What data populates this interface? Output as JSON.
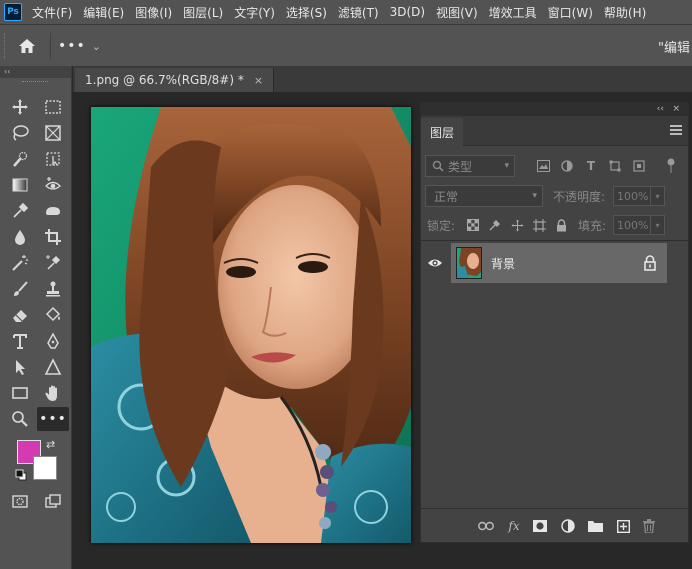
{
  "app": {
    "logo": "Ps",
    "menu": [
      "文件(F)",
      "编辑(E)",
      "图像(I)",
      "图层(L)",
      "文字(Y)",
      "选择(S)",
      "滤镜(T)",
      "3D(D)",
      "视图(V)",
      "增效工具",
      "窗口(W)",
      "帮助(H)"
    ]
  },
  "options_bar": {
    "more_label": "•••",
    "more_chevron": "⌄",
    "right_label": "\"编辑"
  },
  "toolbar": {
    "collapse_glyph": "‹‹"
  },
  "document": {
    "tab_title": "1.png @ 66.7%(RGB/8#) *",
    "tab_close": "×"
  },
  "layers_panel": {
    "collapse_glyph": "‹‹",
    "close_glyph": "×",
    "tab_label": "图层",
    "filter_label": "类型",
    "blend_mode": "正常",
    "opacity_label": "不透明度:",
    "opacity_value": "100%",
    "lock_label": "锁定:",
    "fill_label": "填充:",
    "fill_value": "100%",
    "layers": [
      {
        "name": "背景",
        "visible": true,
        "locked": true
      }
    ],
    "footer_icons": [
      "link-icon",
      "fx-icon",
      "mask-icon",
      "adjustment-icon",
      "group-folder-icon",
      "new-layer-icon",
      "trash-icon"
    ],
    "footer_fx": "fx"
  },
  "colors": {
    "foreground": "#d43bb3",
    "background": "#ffffff",
    "chrome": "#535353",
    "panel": "#434343",
    "selected_layer": "#686868"
  }
}
